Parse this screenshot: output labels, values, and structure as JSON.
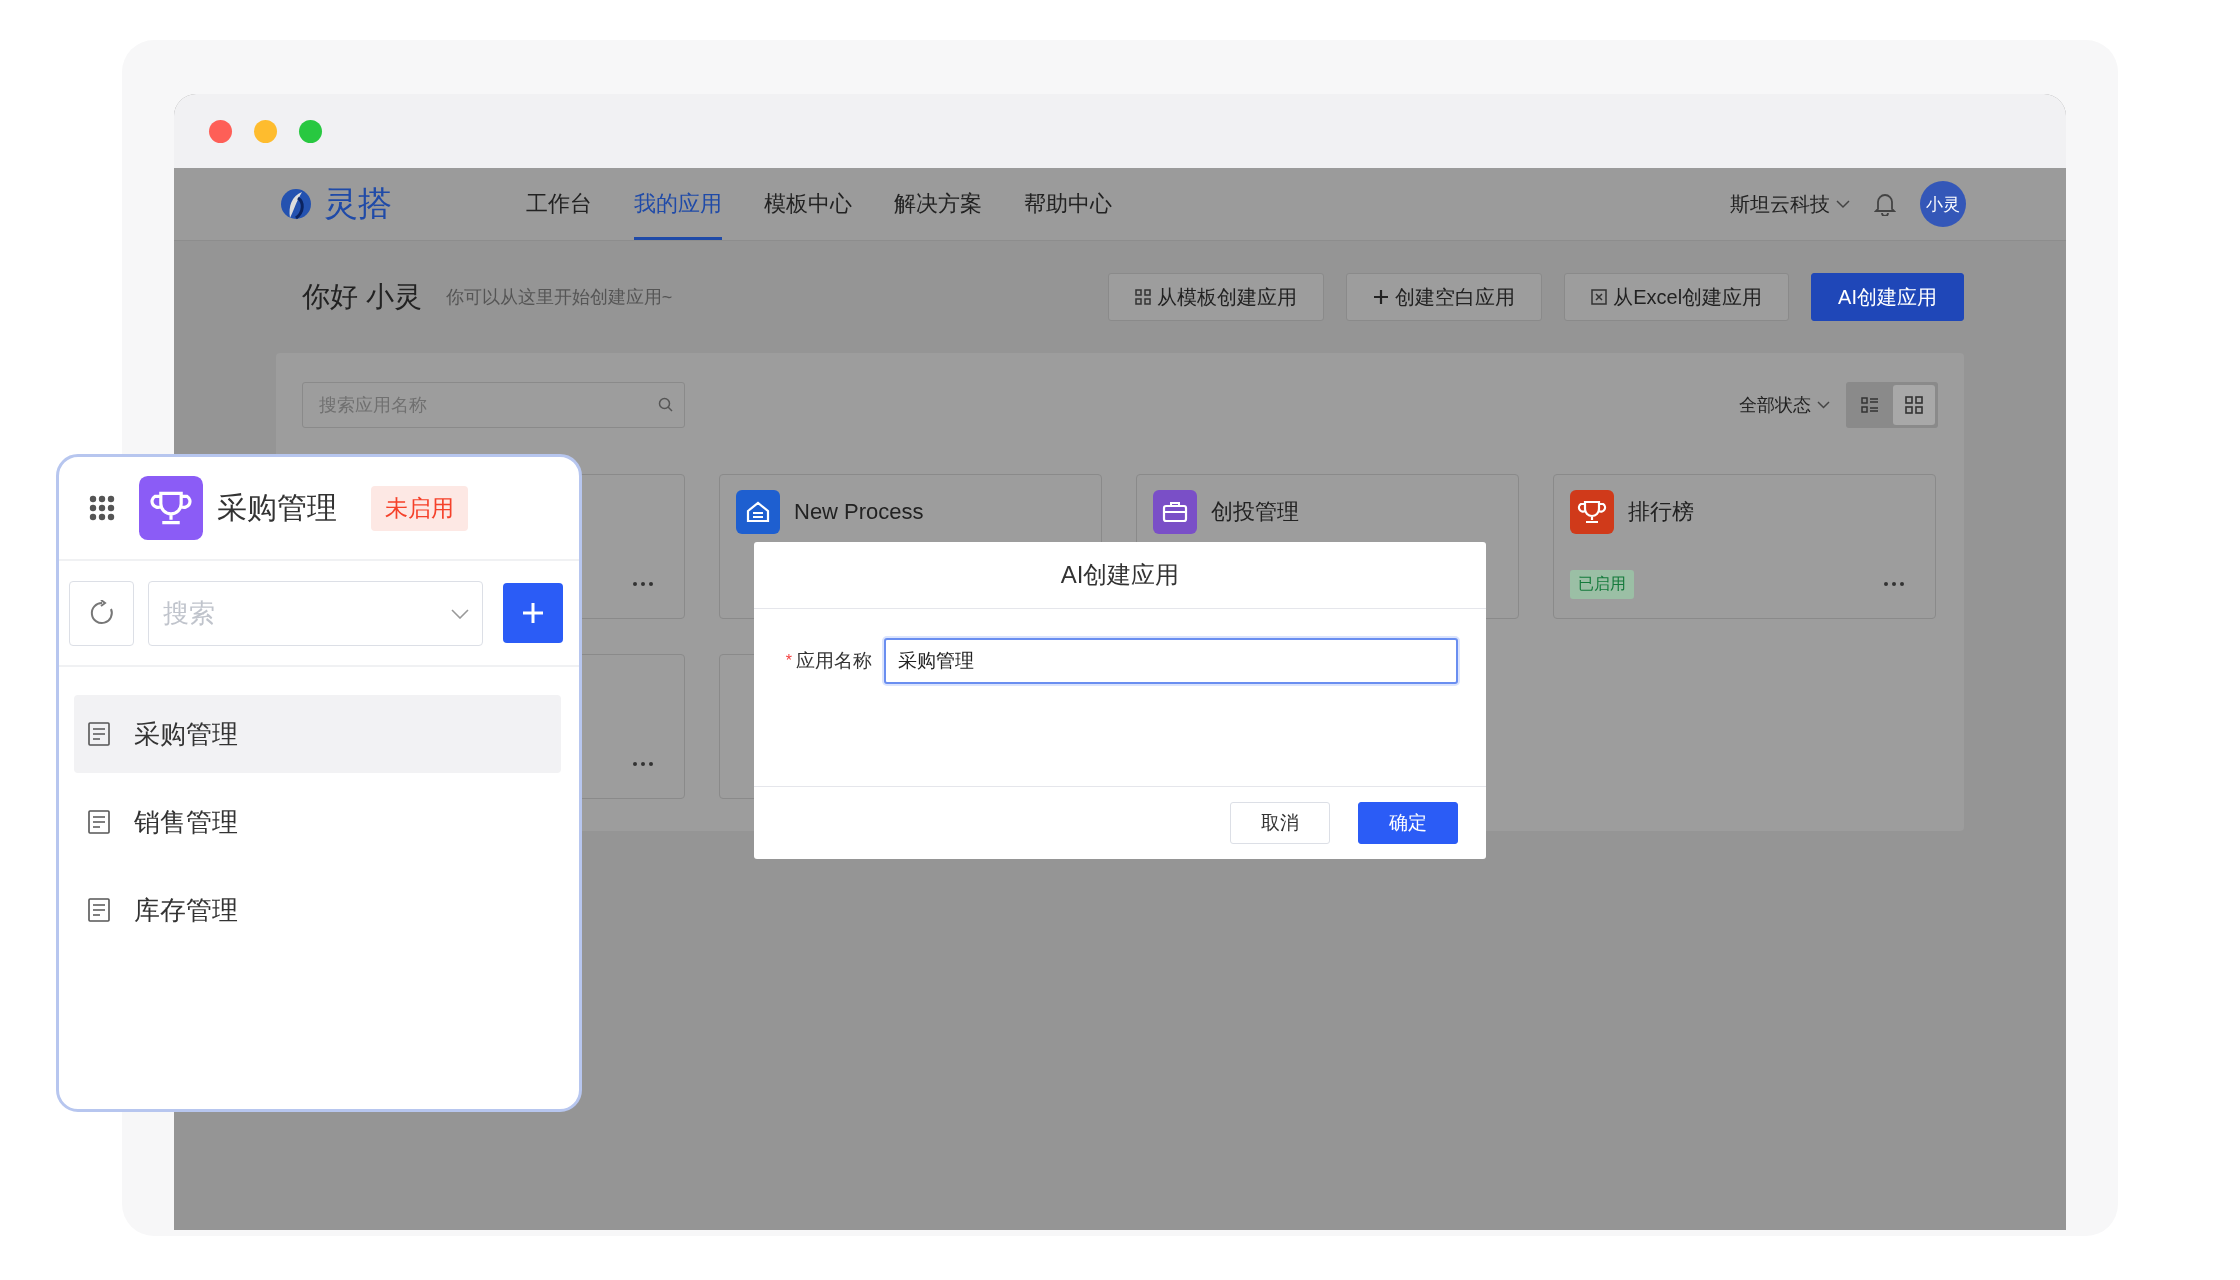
{
  "nav": {
    "logo": "灵搭",
    "items": [
      {
        "label": "工作台",
        "selected": false
      },
      {
        "label": "我的应用",
        "selected": true
      },
      {
        "label": "模板中心",
        "selected": false
      },
      {
        "label": "解决方案",
        "selected": false
      },
      {
        "label": "帮助中心",
        "selected": false
      }
    ],
    "org": "斯坦云科技",
    "avatar": "小灵"
  },
  "header": {
    "greeting": "你好 小灵",
    "hint": "你可以从这里开始创建应用~",
    "buttons": [
      {
        "label": "从模板创建应用",
        "kind": "template"
      },
      {
        "label": "创建空白应用",
        "kind": "blank"
      },
      {
        "label": "从Excel创建应用",
        "kind": "excel"
      },
      {
        "label": "AI创建应用",
        "kind": "primary"
      }
    ]
  },
  "toolbar": {
    "search_placeholder": "搜索应用名称",
    "status_filter": "全部状态",
    "views": [
      {
        "kind": "list",
        "selected": false
      },
      {
        "kind": "grid",
        "selected": true
      }
    ]
  },
  "cards": [
    {
      "kind": "covered",
      "more": true
    },
    {
      "kind": "full",
      "title": "New Process",
      "color": "#1e5fd0"
    },
    {
      "kind": "full",
      "title": "创投管理",
      "color": "#7a4fc7"
    },
    {
      "kind": "full",
      "title": "排行榜",
      "color": "#d03a1a",
      "badge": {
        "text": "已启用",
        "enabled": true
      },
      "more": true
    },
    {
      "kind": "covered",
      "more": true
    },
    {
      "kind": "covered"
    }
  ],
  "side_panel": {
    "app_name": "采购管理",
    "status": {
      "text": "未启用",
      "enabled": false
    },
    "search_placeholder": "搜索",
    "items": [
      {
        "label": "采购管理",
        "selected": true
      },
      {
        "label": "销售管理",
        "selected": false
      },
      {
        "label": "库存管理",
        "selected": false
      }
    ]
  },
  "dialog": {
    "title": "AI创建应用",
    "required_mark": "*",
    "field_label": "应用名称",
    "field_value": "采购管理",
    "buttons": [
      {
        "label": "取消",
        "kind": "default"
      },
      {
        "label": "确定",
        "kind": "primary"
      }
    ]
  }
}
